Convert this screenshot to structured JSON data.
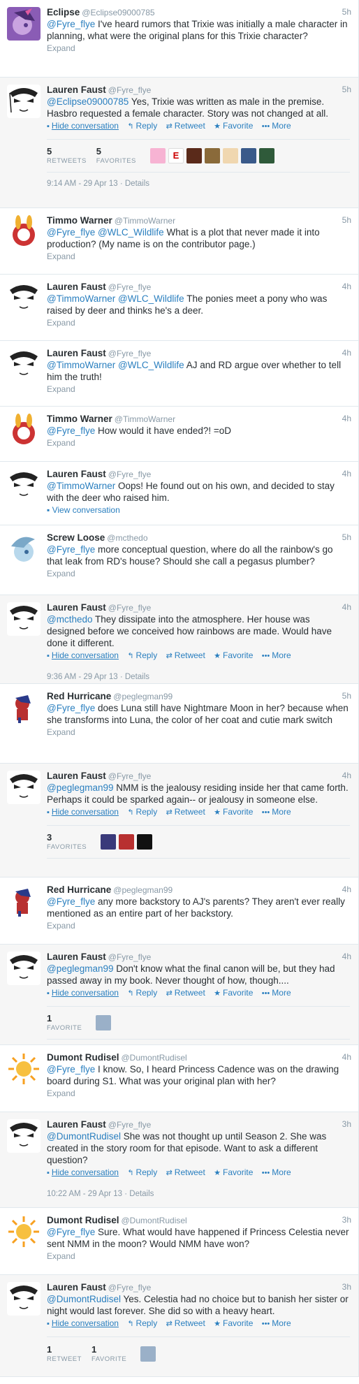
{
  "action_labels": {
    "hide": "Hide conversation",
    "reply": "Reply",
    "retweet": "Retweet",
    "favorite": "Favorite",
    "more": "More",
    "expand": "Expand",
    "view": "View conversation",
    "details": "Details"
  },
  "icons": {
    "reply": "reply-arrow-icon",
    "retweet": "retweet-icon",
    "favorite": "star-icon",
    "more": "ellipsis-icon"
  },
  "tweets": [
    {
      "name": "Eclipse",
      "handle": "@Eclipse09000785",
      "time": "5h",
      "mention": "@Fyre_flye",
      "text": "I've heard rumors that Trixie was initially a male character in planning, what were the original plans for this Trixie character?"
    },
    {
      "name": "Lauren Faust",
      "handle": "@Fyre_flye",
      "time": "5h",
      "mention": "@Eclipse09000785",
      "text": "Yes, Trixie was written as male in the premise. Hasbro requested a female character. Story was not changed at all.",
      "retweets": "5",
      "retweets_label": "RETWEETS",
      "favorites": "5",
      "favorites_label": "FAVORITES",
      "date": "9:14 AM - 29 Apr 13 · "
    },
    {
      "name": "Timmo Warner",
      "handle": "@TimmoWarner",
      "time": "5h",
      "mention": "@Fyre_flye @WLC_Wildlife",
      "text": "What is a plot that never made it into production? (My name is on the contributor page.)"
    },
    {
      "name": "Lauren Faust",
      "handle": "@Fyre_flye",
      "time": "4h",
      "mention": "@TimmoWarner @WLC_Wildlife",
      "text": "The ponies meet a pony who was raised by deer and thinks he's a deer."
    },
    {
      "name": "Lauren Faust",
      "handle": "@Fyre_flye",
      "time": "4h",
      "mention": "@TimmoWarner @WLC_Wildlife",
      "text": "AJ and RD argue over whether to tell him the truth!"
    },
    {
      "name": "Timmo Warner",
      "handle": "@TimmoWarner",
      "time": "4h",
      "mention": "@Fyre_flye",
      "text": "How would it have ended?! =oD"
    },
    {
      "name": "Lauren Faust",
      "handle": "@Fyre_flye",
      "time": "4h",
      "mention": "@TimmoWarner",
      "text": "Oops! He found out on his own, and decided to stay with the deer who raised him."
    },
    {
      "name": "Screw Loose",
      "handle": "@mcthedo",
      "time": "5h",
      "mention": "@Fyre_flye",
      "text": "more conceptual question, where do all the rainbow's go that leak from RD's house? Should she call a pegasus plumber?"
    },
    {
      "name": "Lauren Faust",
      "handle": "@Fyre_flye",
      "time": "4h",
      "mention": "@mcthedo",
      "text": "They dissipate into the atmosphere. Her house was designed before we conceived how rainbows are made. Would have done it different.",
      "date": "9:36 AM - 29 Apr 13 · "
    },
    {
      "name": "Red Hurricane",
      "handle": "@peglegman99",
      "time": "5h",
      "mention": "@Fyre_flye",
      "text": "does Luna still have Nightmare Moon in her? because when she transforms into Luna, the color of her coat and cutie mark switch"
    },
    {
      "name": "Lauren Faust",
      "handle": "@Fyre_flye",
      "time": "4h",
      "mention": "@peglegman99",
      "text": "NMM is the jealousy residing inside her that came forth. Perhaps it could be sparked again-- or jealousy in someone else.",
      "favorites": "3",
      "favorites_label": "FAVORITES"
    },
    {
      "name": "Red Hurricane",
      "handle": "@peglegman99",
      "time": "4h",
      "mention": "@Fyre_flye",
      "text": "any more backstory to AJ's parents? They aren't ever really mentioned as an entire part of her backstory."
    },
    {
      "name": "Lauren Faust",
      "handle": "@Fyre_flye",
      "time": "4h",
      "mention": "@peglegman99",
      "text": "Don't know what the final canon will be, but they had passed away in my book. Never thought of how, though....",
      "favorites": "1",
      "favorites_label": "FAVORITE"
    },
    {
      "name": "Dumont Rudisel",
      "handle": "@DumontRudisel",
      "time": "4h",
      "mention": "@Fyre_flye",
      "text": "I know. So, I heard Princess Cadence was on the drawing board during S1. What was your original plan with her?"
    },
    {
      "name": "Lauren Faust",
      "handle": "@Fyre_flye",
      "time": "3h",
      "mention": "@DumontRudisel",
      "text": "She was not thought up until Season 2. She was created in the story room for that episode. Want to ask a different question?",
      "date": "10:22 AM - 29 Apr 13 · "
    },
    {
      "name": "Dumont Rudisel",
      "handle": "@DumontRudisel",
      "time": "3h",
      "mention": "@Fyre_flye",
      "text": "Sure. What would have happened if Princess Celestia never sent NMM in the moon? Would NMM have won?"
    },
    {
      "name": "Lauren Faust",
      "handle": "@Fyre_flye",
      "time": "3h",
      "mention": "@DumontRudisel",
      "text": "Yes. Celestia had no choice but to banish her sister or night would last forever. She did so with a heavy heart.",
      "retweets": "1",
      "retweets_label": "RETWEET",
      "favorites": "1",
      "favorites_label": "FAVORITE"
    }
  ]
}
